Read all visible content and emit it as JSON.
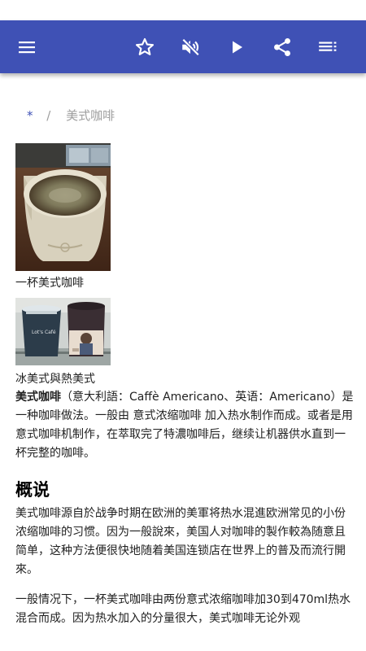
{
  "appbar": {
    "icons": [
      "menu-icon",
      "star-outline-icon",
      "volume-off-icon",
      "play-icon",
      "share-icon",
      "playlist-icon"
    ]
  },
  "breadcrumb": {
    "home": "*",
    "separator": "/",
    "current": "美式咖啡"
  },
  "figures": [
    {
      "caption": "一杯美式咖啡"
    },
    {
      "caption": "冰美式與熱美式"
    }
  ],
  "intro": {
    "term": "美式咖啡",
    "text_1": "（意大利語：Caffè Americano、英语：Americano）是一种咖啡做法。一般由 ",
    "link_espresso": "意式浓缩咖啡",
    "text_2": " 加入热水制作而成。或者是用意式咖啡机制作，在萃取完了特濃咖啡后，继续让机器供水直到一杯完整的咖啡。"
  },
  "section": {
    "heading": "概说",
    "paragraph_1": "美式咖啡源自於战争时期在欧洲的美軍将热水混進欧洲常见的小份浓缩咖啡的习惯。因为一般說來，美国人对咖啡的製作較為随意且简单，这种方法便很快地随着美国连锁店在世界上的普及而流行開來。",
    "paragraph_2": "一般情况下，一杯美式咖啡由两份意式浓缩咖啡加30到470ml热水混合而成。因为热水加入的分量很大，美式咖啡无论外观"
  }
}
